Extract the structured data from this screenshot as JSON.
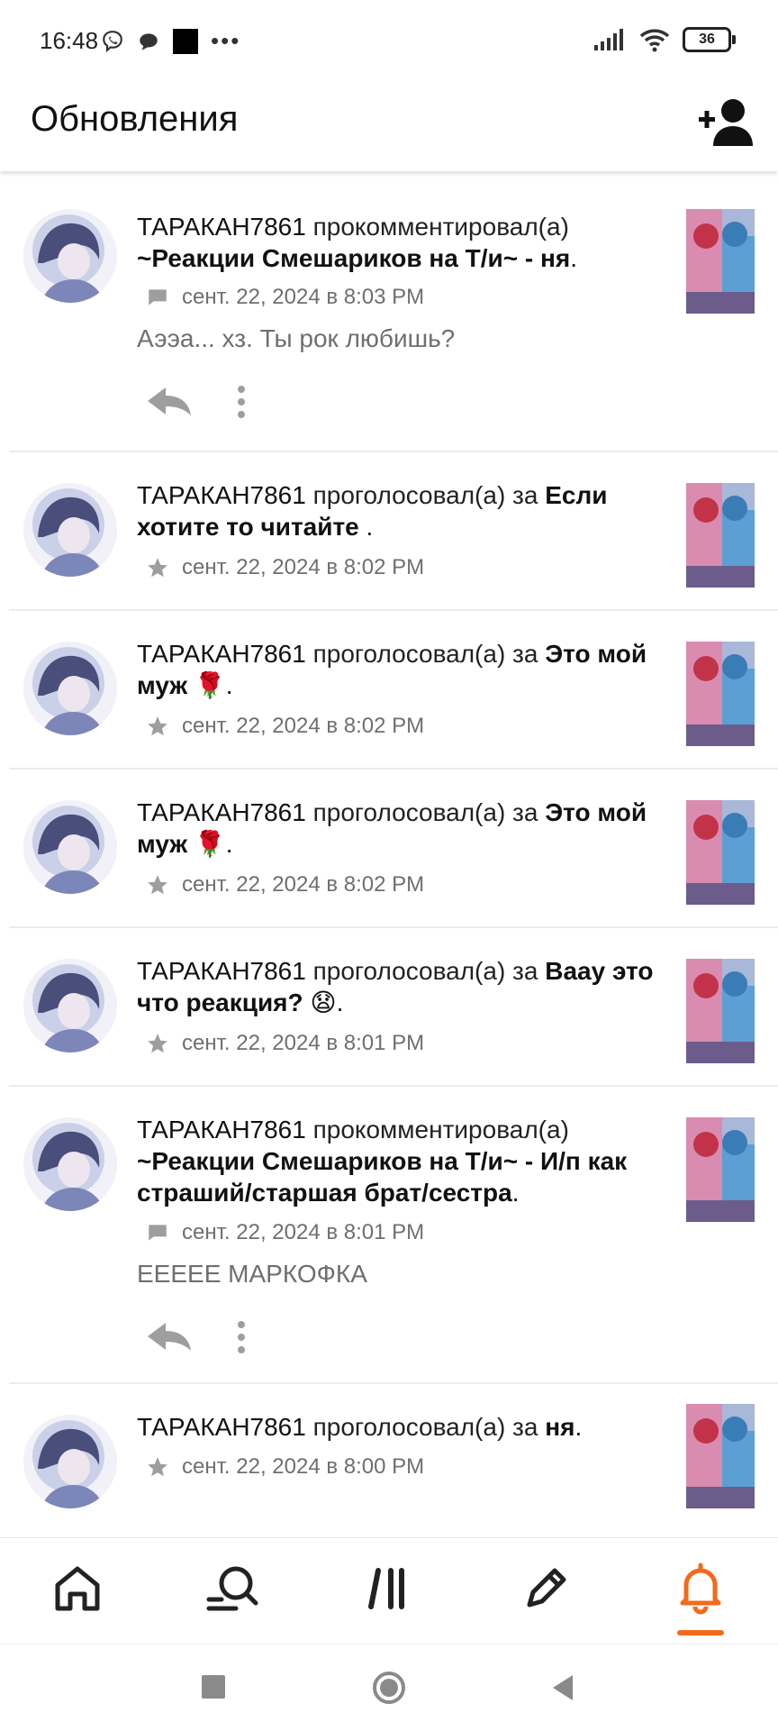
{
  "status_bar": {
    "time": "16:48",
    "battery": "36"
  },
  "app_bar": {
    "title": "Обновления"
  },
  "feed": [
    {
      "user": "ТАРАКАН7861",
      "verb": "прокомментировал(а)",
      "story": "~Реакции Смешариков на Т/и~ - ня",
      "suffix": ".",
      "meta_icon": "comment-icon",
      "time": "сент. 22, 2024 в 8:03 PM",
      "comment": "Аээа... хз. Ты рок любишь?"
    },
    {
      "user": "ТАРАКАН7861",
      "verb": "проголосовал(а) за",
      "story": "Если хотите то читайте",
      "suffix": " .",
      "meta_icon": "star-icon",
      "time": "сент. 22, 2024 в 8:02 PM"
    },
    {
      "user": "ТАРАКАН7861",
      "verb": "проголосовал(а) за",
      "story": "Это мой муж 🌹",
      "suffix": ".",
      "meta_icon": "star-icon",
      "time": "сент. 22, 2024 в 8:02 PM"
    },
    {
      "user": "ТАРАКАН7861",
      "verb": "проголосовал(а) за",
      "story": "Это мой муж 🌹",
      "suffix": ".",
      "meta_icon": "star-icon",
      "time": "сент. 22, 2024 в 8:02 PM"
    },
    {
      "user": "ТАРАКАН7861",
      "verb": "проголосовал(а) за",
      "story": "Ваау это что реакция? 😧",
      "suffix": ".",
      "meta_icon": "star-icon",
      "time": "сент. 22, 2024 в 8:01 PM"
    },
    {
      "user": "ТАРАКАН7861",
      "verb": "прокомментировал(а)",
      "story": "~Реакции Смешариков на Т/и~ - И/п как страший/старшая брат/сестра",
      "suffix": ".",
      "meta_icon": "comment-icon",
      "time": "сент. 22, 2024 в 8:01 PM",
      "comment": "ЕЕЕЕЕ МАРКОФКА"
    },
    {
      "user": "ТАРАКАН7861",
      "verb": "проголосовал(а) за",
      "story": "ня",
      "suffix": ".",
      "meta_icon": "star-icon",
      "time": "сент. 22, 2024 в 8:00 PM"
    }
  ],
  "bottom_nav": [
    {
      "name": "home-icon"
    },
    {
      "name": "search-icon"
    },
    {
      "name": "library-icon"
    },
    {
      "name": "write-icon"
    },
    {
      "name": "notifications-icon",
      "active": true
    }
  ],
  "colors": {
    "accent": "#f26a1b",
    "meta_text": "#6f6f6f",
    "icon_gray": "#9e9e9e"
  }
}
